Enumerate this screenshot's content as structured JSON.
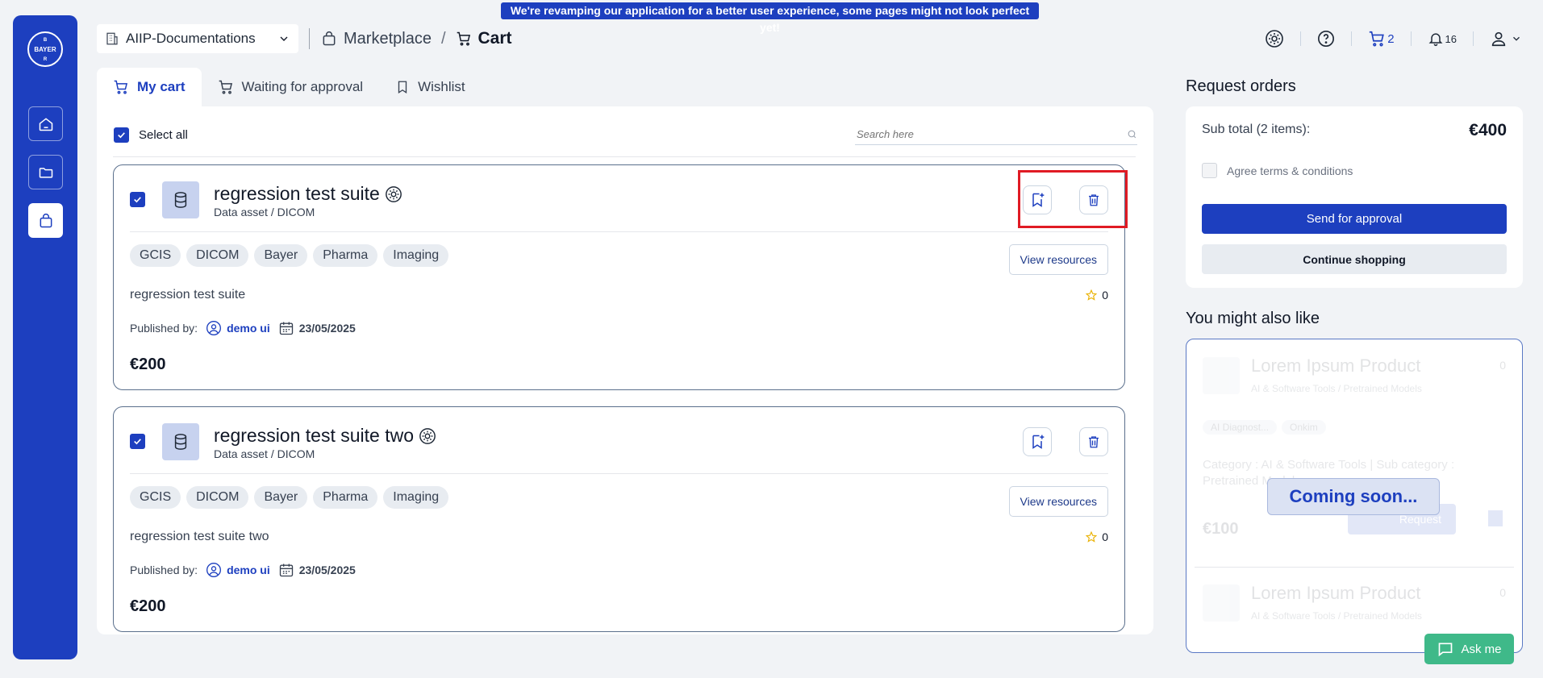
{
  "banner": {
    "text": "We're revamping our application for a better user experience, some pages might not look perfect yet!"
  },
  "sidebar": {
    "logo_text": "BAYER"
  },
  "header": {
    "workspace": "AIIP-Documentations",
    "breadcrumb": {
      "marketplace": "Marketplace",
      "separator": "/",
      "current": "Cart"
    },
    "cart_count": "2",
    "notification_count": "16"
  },
  "tabs": [
    {
      "label": "My cart"
    },
    {
      "label": "Waiting for approval"
    },
    {
      "label": "Wishlist"
    }
  ],
  "cart": {
    "select_all": "Select all",
    "search_placeholder": "Search here",
    "items": [
      {
        "title": "regression test suite",
        "subtitle": "Data asset / DICOM",
        "tags": [
          "GCIS",
          "DICOM",
          "Bayer",
          "Pharma",
          "Imaging"
        ],
        "view_resources": "View resources",
        "description": "regression test suite",
        "rating": "0",
        "published_label": "Published by:",
        "author": "demo ui",
        "date": "23/05/2025",
        "price": "€200"
      },
      {
        "title": "regression test suite two",
        "subtitle": "Data asset / DICOM",
        "tags": [
          "GCIS",
          "DICOM",
          "Bayer",
          "Pharma",
          "Imaging"
        ],
        "view_resources": "View resources",
        "description": "regression test suite two",
        "rating": "0",
        "published_label": "Published by:",
        "author": "demo ui",
        "date": "23/05/2025",
        "price": "€200"
      }
    ]
  },
  "orders": {
    "title": "Request orders",
    "subtotal_label": "Sub total (2 items):",
    "subtotal_value": "€400",
    "agree_label": "Agree terms & conditions",
    "send_button": "Send for approval",
    "continue_button": "Continue shopping"
  },
  "recommend": {
    "title": "You might also like",
    "coming_soon": "Coming soon...",
    "products": [
      {
        "name": "Lorem Ipsum Product",
        "category": "AI & Software Tools / Pretrained Models",
        "rating": "0",
        "tags": [
          "AI Diagnost...",
          "Onkim"
        ],
        "category_line": "Category : AI & Software Tools | Sub category : Pretrained Models",
        "price": "€100",
        "request": "Request"
      },
      {
        "name": "Lorem Ipsum Product",
        "category": "AI & Software Tools / Pretrained Models",
        "rating": "0"
      }
    ]
  },
  "chat": {
    "label": "Ask me"
  },
  "colors": {
    "primary": "#1d3fbf",
    "highlight": "#e01b24",
    "chat": "#3fb989"
  }
}
